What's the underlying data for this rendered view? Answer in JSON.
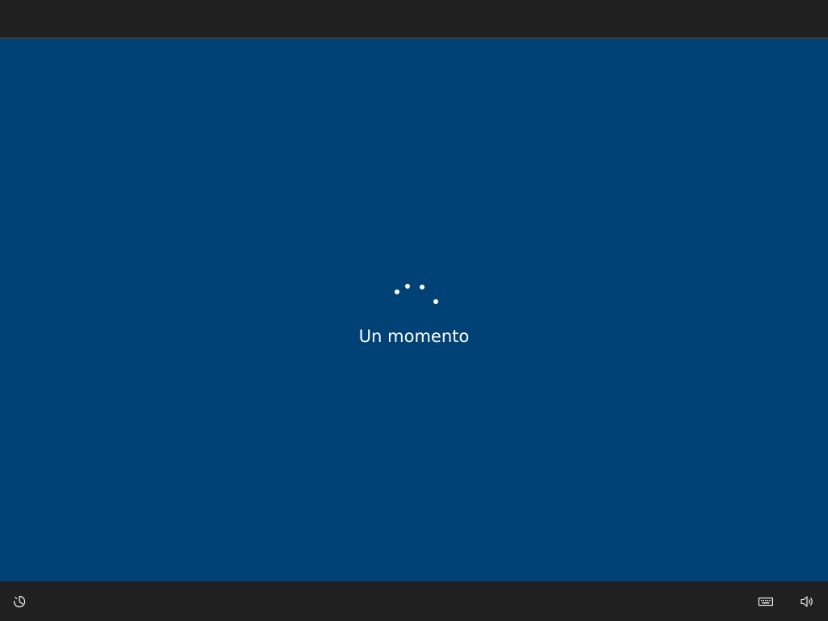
{
  "status": {
    "message": "Un momento"
  },
  "spinner": {
    "dot_count": 4,
    "color": "#ffffff"
  },
  "colors": {
    "background": "#004275",
    "bars": "#202020"
  },
  "bottom_bar": {
    "left_icon": "ease-of-access-icon",
    "right_icons": [
      "keyboard-icon",
      "volume-icon"
    ]
  }
}
